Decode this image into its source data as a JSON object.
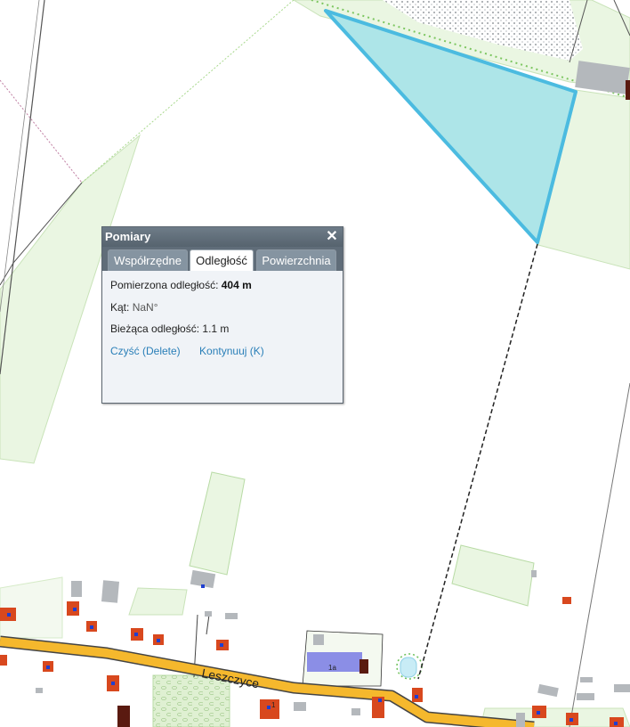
{
  "panel": {
    "title": "Pomiary",
    "close_glyph": "✕",
    "tabs": [
      "Współrzędne",
      "Odległość",
      "Powierzchnia"
    ],
    "active_tab": "Odległość",
    "measured_label": "Pomierzona odległość:",
    "measured_value": "404 m",
    "angle_label": "Kąt:",
    "angle_value": "NaN°",
    "current_label": "Bieżąca odległość:",
    "current_value": "1.1 m",
    "clear_link": "Czyść (Delete)",
    "continue_link": "Kontynuuj (K)"
  },
  "map": {
    "street_label": "Leszczyce",
    "house_numbers": [
      "1a",
      "1"
    ],
    "colors": {
      "measured_polygon_fill": "#ade5e8",
      "measured_polygon_stroke": "#4bbbe0",
      "parcel_green": "#eaf6e2",
      "road_yellow": "#f5b82d",
      "building_red": "#d8481e",
      "building_gray": "#b4b8bc",
      "building_blue": "#8b8ee6",
      "water": "#c8ecf6"
    }
  }
}
